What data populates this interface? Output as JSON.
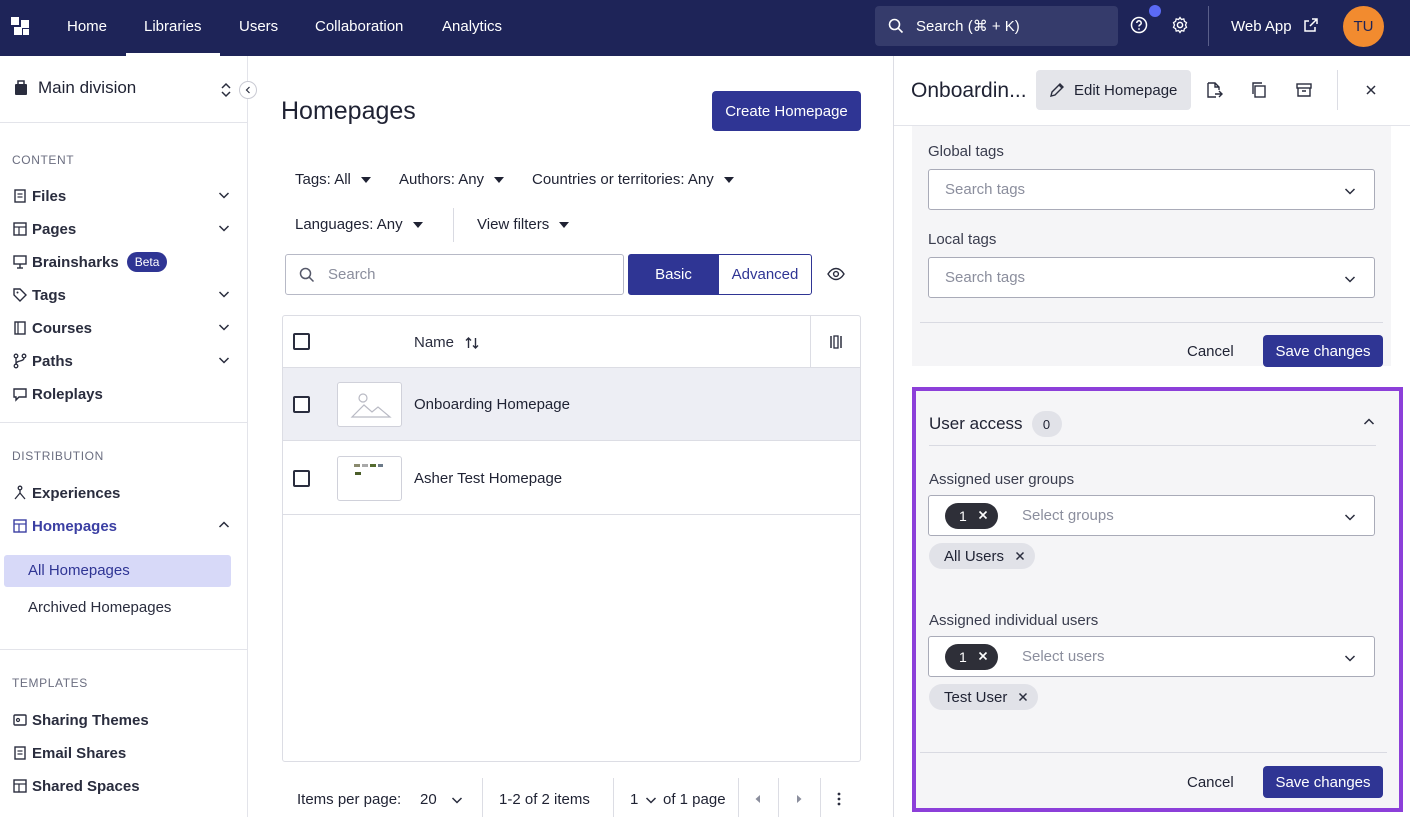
{
  "nav": {
    "tabs": [
      "Home",
      "Libraries",
      "Users",
      "Collaboration",
      "Analytics"
    ],
    "active_tab": "Libraries",
    "search_placeholder": "Search (⌘ + K)",
    "web_app_label": "Web App",
    "avatar_initials": "TU"
  },
  "sidebar": {
    "division": "Main division",
    "sections": {
      "content": "CONTENT",
      "distribution": "DISTRIBUTION",
      "templates": "TEMPLATES"
    },
    "content_items": [
      "Files",
      "Pages",
      "Brainsharks",
      "Tags",
      "Courses",
      "Paths",
      "Roleplays"
    ],
    "beta_badge": "Beta",
    "distribution_items": [
      "Experiences",
      "Homepages"
    ],
    "homepage_sub": [
      "All Homepages",
      "Archived Homepages"
    ],
    "template_items": [
      "Sharing Themes",
      "Email Shares",
      "Shared Spaces"
    ]
  },
  "main": {
    "title": "Homepages",
    "create_button": "Create Homepage",
    "filters": {
      "tags": "Tags: All",
      "authors": "Authors: Any",
      "countries": "Countries or territories: Any",
      "languages": "Languages: Any",
      "view_filters": "View filters"
    },
    "search_placeholder": "Search",
    "mode_basic": "Basic",
    "mode_advanced": "Advanced",
    "table": {
      "col_name": "Name",
      "rows": [
        "Onboarding Homepage",
        "Asher Test Homepage"
      ]
    },
    "pager": {
      "items_per_page_label": "Items per page:",
      "items_per_page": "20",
      "range": "1-2 of 2 items",
      "page": "1",
      "of_pages": "of 1 page"
    }
  },
  "panel": {
    "title": "Onboardin...",
    "edit_button": "Edit Homepage",
    "global_tags_label": "Global tags",
    "local_tags_label": "Local tags",
    "tags_placeholder": "Search tags",
    "cancel": "Cancel",
    "save": "Save changes",
    "access": {
      "title": "User access",
      "count": "0",
      "groups_label": "Assigned user groups",
      "groups_count": "1",
      "groups_placeholder": "Select groups",
      "group_chip": "All Users",
      "users_label": "Assigned individual users",
      "users_count": "1",
      "users_placeholder": "Select users",
      "user_chip": "Test User",
      "cancel": "Cancel",
      "save": "Save changes"
    }
  },
  "colors": {
    "nav_bg": "#1e2458",
    "primary": "#2f3594",
    "highlight_border": "#8c3fd9",
    "avatar_bg": "#f28b2f"
  }
}
